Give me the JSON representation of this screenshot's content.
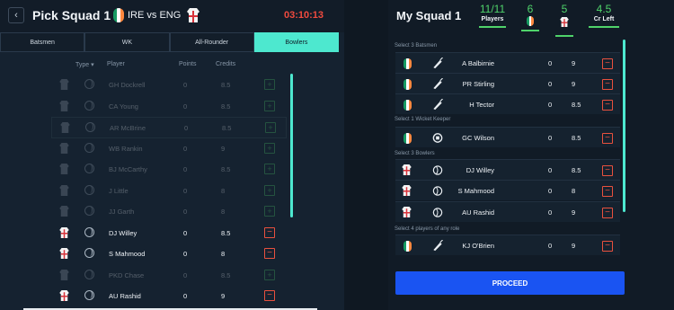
{
  "header": {
    "back_icon": "chevron-left-icon",
    "title": "Pick Squad 1",
    "match": "IRE vs ENG",
    "timer": "03:10:13"
  },
  "tabs": [
    "Batsmen",
    "WK",
    "All-Rounder",
    "Bowlers"
  ],
  "active_tab": "Bowlers",
  "columns": {
    "type": "Type",
    "player": "Player",
    "points": "Points",
    "credits": "Credits"
  },
  "players": [
    {
      "name": "GH Dockrell",
      "points": "0",
      "credits": "8.5",
      "team": "IRE",
      "selected": false
    },
    {
      "name": "CA Young",
      "points": "0",
      "credits": "8.5",
      "team": "IRE",
      "selected": false
    },
    {
      "name": "AR McBrine",
      "points": "0",
      "credits": "8.5",
      "team": "IRE",
      "selected": false
    },
    {
      "name": "WB Rankin",
      "points": "0",
      "credits": "9",
      "team": "IRE",
      "selected": false
    },
    {
      "name": "BJ McCarthy",
      "points": "0",
      "credits": "8.5",
      "team": "IRE",
      "selected": false
    },
    {
      "name": "J Little",
      "points": "0",
      "credits": "8",
      "team": "IRE",
      "selected": false
    },
    {
      "name": "JJ Garth",
      "points": "0",
      "credits": "8",
      "team": "IRE",
      "selected": false
    },
    {
      "name": "DJ Willey",
      "points": "0",
      "credits": "8.5",
      "team": "ENG",
      "selected": true
    },
    {
      "name": "S Mahmood",
      "points": "0",
      "credits": "8",
      "team": "ENG",
      "selected": true
    },
    {
      "name": "PKD Chase",
      "points": "0",
      "credits": "8.5",
      "team": "IRE",
      "selected": false
    },
    {
      "name": "AU Rashid",
      "points": "0",
      "credits": "9",
      "team": "ENG",
      "selected": true
    }
  ],
  "squad": {
    "title": "My Squad 1",
    "players_count": "11/11",
    "players_label": "Players",
    "ire_count": "6",
    "eng_count": "5",
    "credits_left": "4.5",
    "credits_label": "Cr Left"
  },
  "sections": [
    {
      "label": "Select 3 Batsmen"
    },
    {
      "label": "Select 1 Wicket Keeper"
    },
    {
      "label": "Select 3 Bowlers"
    },
    {
      "label": "Select 4 players of any role"
    }
  ],
  "squad_players": [
    {
      "name": "A Balbirnie",
      "points": "0",
      "credits": "9",
      "team": "IRE",
      "role": "bat"
    },
    {
      "name": "PR Stirling",
      "points": "0",
      "credits": "9",
      "team": "IRE",
      "role": "bat"
    },
    {
      "name": "H Tector",
      "points": "0",
      "credits": "8.5",
      "team": "IRE",
      "role": "bat"
    },
    {
      "name": "GC Wilson",
      "points": "0",
      "credits": "8.5",
      "team": "IRE",
      "role": "wk"
    },
    {
      "name": "DJ Willey",
      "points": "0",
      "credits": "8.5",
      "team": "ENG",
      "role": "bowl"
    },
    {
      "name": "S Mahmood",
      "points": "0",
      "credits": "8",
      "team": "ENG",
      "role": "bowl"
    },
    {
      "name": "AU Rashid",
      "points": "0",
      "credits": "9",
      "team": "ENG",
      "role": "bowl"
    },
    {
      "name": "KJ O'Brien",
      "points": "0",
      "credits": "9",
      "team": "IRE",
      "role": "bat"
    }
  ],
  "proceed_label": "PROCEED",
  "colors": {
    "accent": "#4de8cf",
    "green": "#4fd36a",
    "red": "#e9513e",
    "timer": "#f04a3e",
    "proceed": "#1a54f2"
  }
}
